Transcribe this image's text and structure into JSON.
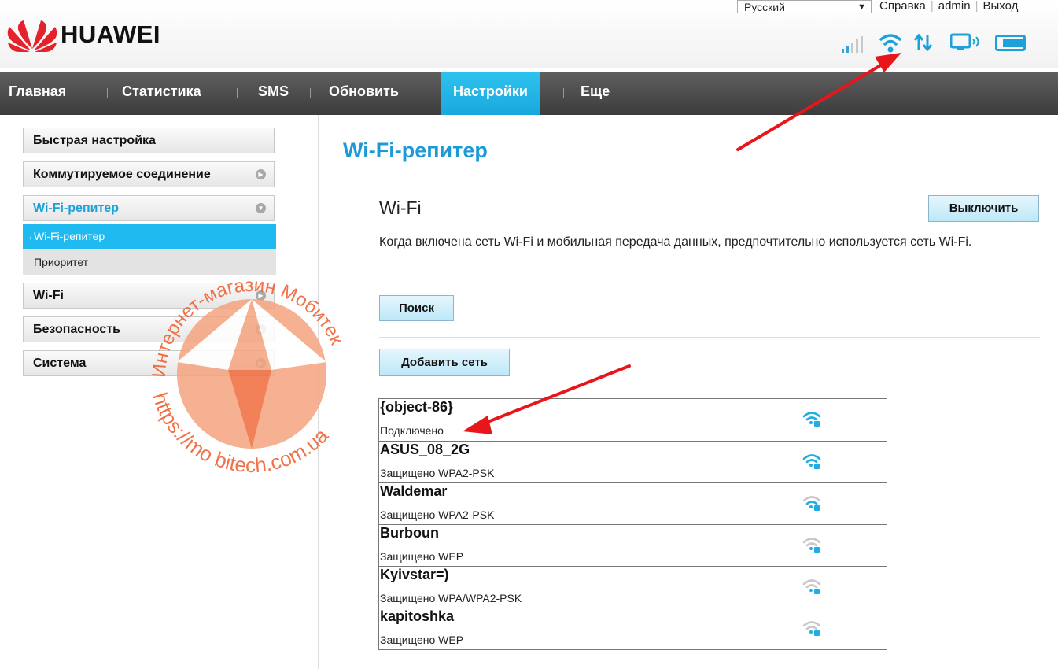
{
  "header": {
    "brand": "HUAWEI",
    "language": "Русский",
    "links": [
      "Справка",
      "admin",
      "Выход"
    ]
  },
  "nav": {
    "items": [
      {
        "label": "Главная"
      },
      {
        "label": "Статистика"
      },
      {
        "label": "SMS"
      },
      {
        "label": "Обновить"
      },
      {
        "label": "Настройки",
        "active": true
      },
      {
        "label": "Еще"
      }
    ]
  },
  "sidebar": {
    "items": [
      {
        "label": "Быстрая настройка"
      },
      {
        "label": "Коммутируемое соединение"
      },
      {
        "label": "Wi-Fi-репитер",
        "expanded": true
      },
      {
        "label": "Wi-Fi",
        "sub": false
      },
      {
        "label": "Безопасность"
      },
      {
        "label": "Система"
      }
    ],
    "subitems": [
      {
        "label": "Wi-Fi-репитер",
        "active": true
      },
      {
        "label": "Приоритет"
      }
    ]
  },
  "watermark": {
    "arc_top": "Интернет-магазин Мобитек",
    "arc_bottom": "https://mo bitech.com.ua"
  },
  "main": {
    "page_title": "Wi-Fi-репитер",
    "section_title": "Wi-Fi",
    "toggle_button": "Выключить",
    "description": "Когда включена сеть Wi-Fi и мобильная передача данных, предпочтительно используется сеть Wi-Fi.",
    "search_button": "Поиск",
    "add_button": "Добавить сеть",
    "networks": [
      {
        "name": "{object-86}",
        "status": "Подключено",
        "signal": "strong"
      },
      {
        "name": "ASUS_08_2G",
        "status": "Защищено WPA2-PSK",
        "signal": "strong"
      },
      {
        "name": "Waldemar",
        "status": "Защищено WPA2-PSK",
        "signal": "weak"
      },
      {
        "name": "Burboun",
        "status": "Защищено WEP",
        "signal": "weak"
      },
      {
        "name": "Kyivstar=)",
        "status": "Защищено WPA/WPA2-PSK",
        "signal": "weak"
      },
      {
        "name": "kapitoshka",
        "status": "Защищено WEP",
        "signal": "weak"
      }
    ]
  },
  "colors": {
    "accent": "#1ebaf0",
    "title_blue": "#1d9ad6",
    "nav_bg": "#4a4a4a",
    "annotation_red": "#e8161b",
    "watermark": "#f05a28"
  }
}
